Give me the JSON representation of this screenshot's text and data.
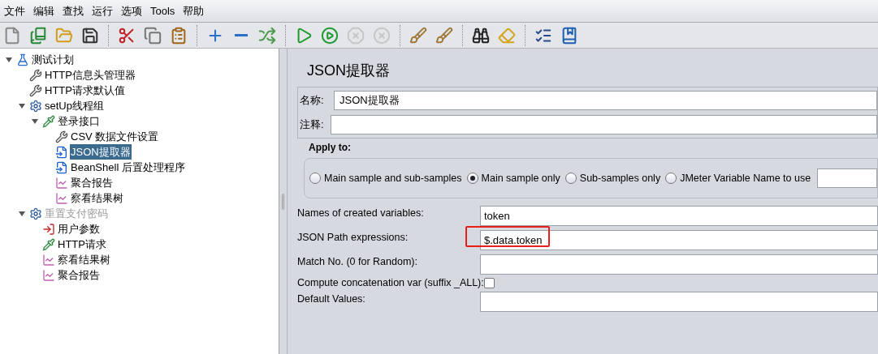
{
  "menu": [
    "文件",
    "编辑",
    "查找",
    "运行",
    "选项",
    "Tools",
    "帮助"
  ],
  "toolbar": [
    {
      "kind": "new",
      "disabled": false
    },
    {
      "kind": "templates",
      "disabled": false
    },
    {
      "kind": "open",
      "disabled": false
    },
    {
      "kind": "save",
      "disabled": false
    },
    {
      "kind": "separator"
    },
    {
      "kind": "cut",
      "disabled": false
    },
    {
      "kind": "copy",
      "disabled": false
    },
    {
      "kind": "paste",
      "disabled": false
    },
    {
      "kind": "separator"
    },
    {
      "kind": "expand",
      "disabled": false
    },
    {
      "kind": "collapse",
      "disabled": false
    },
    {
      "kind": "toggle",
      "disabled": false
    },
    {
      "kind": "separator"
    },
    {
      "kind": "start",
      "disabled": false
    },
    {
      "kind": "start-no-pause",
      "disabled": false
    },
    {
      "kind": "stop",
      "disabled": true
    },
    {
      "kind": "shutdown",
      "disabled": true
    },
    {
      "kind": "separator"
    },
    {
      "kind": "clear",
      "disabled": false
    },
    {
      "kind": "clear-all",
      "disabled": false
    },
    {
      "kind": "separator"
    },
    {
      "kind": "search",
      "disabled": false
    },
    {
      "kind": "reset-search",
      "disabled": false
    },
    {
      "kind": "separator"
    },
    {
      "kind": "function-helper",
      "disabled": false
    },
    {
      "kind": "help",
      "disabled": false
    }
  ],
  "tree": [
    {
      "label": "测试计划",
      "kind": "plan",
      "expanded": true,
      "selected": false,
      "disabled": false,
      "children": [
        {
          "label": "HTTP信息头管理器",
          "kind": "config",
          "selected": false,
          "disabled": false
        },
        {
          "label": "HTTP请求默认值",
          "kind": "config",
          "selected": false,
          "disabled": false
        },
        {
          "label": "setUp线程组",
          "kind": "threadgroup",
          "expanded": true,
          "selected": false,
          "disabled": false,
          "children": [
            {
              "label": "登录接口",
              "kind": "sampler",
              "expanded": true,
              "selected": false,
              "disabled": false,
              "children": [
                {
                  "label": "CSV 数据文件设置",
                  "kind": "config",
                  "selected": false,
                  "disabled": false
                },
                {
                  "label": "JSON提取器",
                  "kind": "postprocessor",
                  "selected": true,
                  "disabled": false
                },
                {
                  "label": "BeanShell 后置处理程序",
                  "kind": "postprocessor",
                  "selected": false,
                  "disabled": false
                },
                {
                  "label": "聚合报告",
                  "kind": "listener",
                  "selected": false,
                  "disabled": false
                },
                {
                  "label": "察看结果树",
                  "kind": "listener",
                  "selected": false,
                  "disabled": false
                }
              ]
            }
          ]
        },
        {
          "label": "重置支付密码",
          "kind": "threadgroup",
          "expanded": true,
          "selected": false,
          "disabled": true,
          "children": [
            {
              "label": "用户参数",
              "kind": "preprocessor",
              "selected": false,
              "disabled": false
            },
            {
              "label": "HTTP请求",
              "kind": "sampler",
              "selected": false,
              "disabled": false
            },
            {
              "label": "察看结果树",
              "kind": "listener",
              "selected": false,
              "disabled": false
            },
            {
              "label": "聚合报告",
              "kind": "listener",
              "selected": false,
              "disabled": false
            }
          ]
        }
      ]
    }
  ],
  "panel": {
    "title": "JSON提取器",
    "name": {
      "label": "名称:",
      "value": "JSON提取器"
    },
    "comment": {
      "label": "注释:"
    },
    "apply_to": {
      "title": "Apply to:",
      "options": [
        {
          "label": "Main sample and sub-samples",
          "selected": false
        },
        {
          "label": "Main sample only",
          "selected": true
        },
        {
          "label": "Sub-samples only",
          "selected": false
        },
        {
          "label": "JMeter Variable Name to use",
          "selected": false
        }
      ]
    },
    "fields": [
      {
        "kind": "text",
        "label": "Names of created variables:",
        "value": "token",
        "highlighted": false
      },
      {
        "kind": "text",
        "label": "JSON Path expressions:",
        "value": "$.data.token",
        "highlighted": true
      },
      {
        "kind": "text",
        "label": "Match No. (0 for Random):",
        "highlighted": false
      },
      {
        "kind": "checkbox",
        "label": "Compute concatenation var (suffix _ALL):",
        "checked": false
      },
      {
        "kind": "text",
        "label": "Default Values:",
        "highlighted": false
      }
    ]
  }
}
